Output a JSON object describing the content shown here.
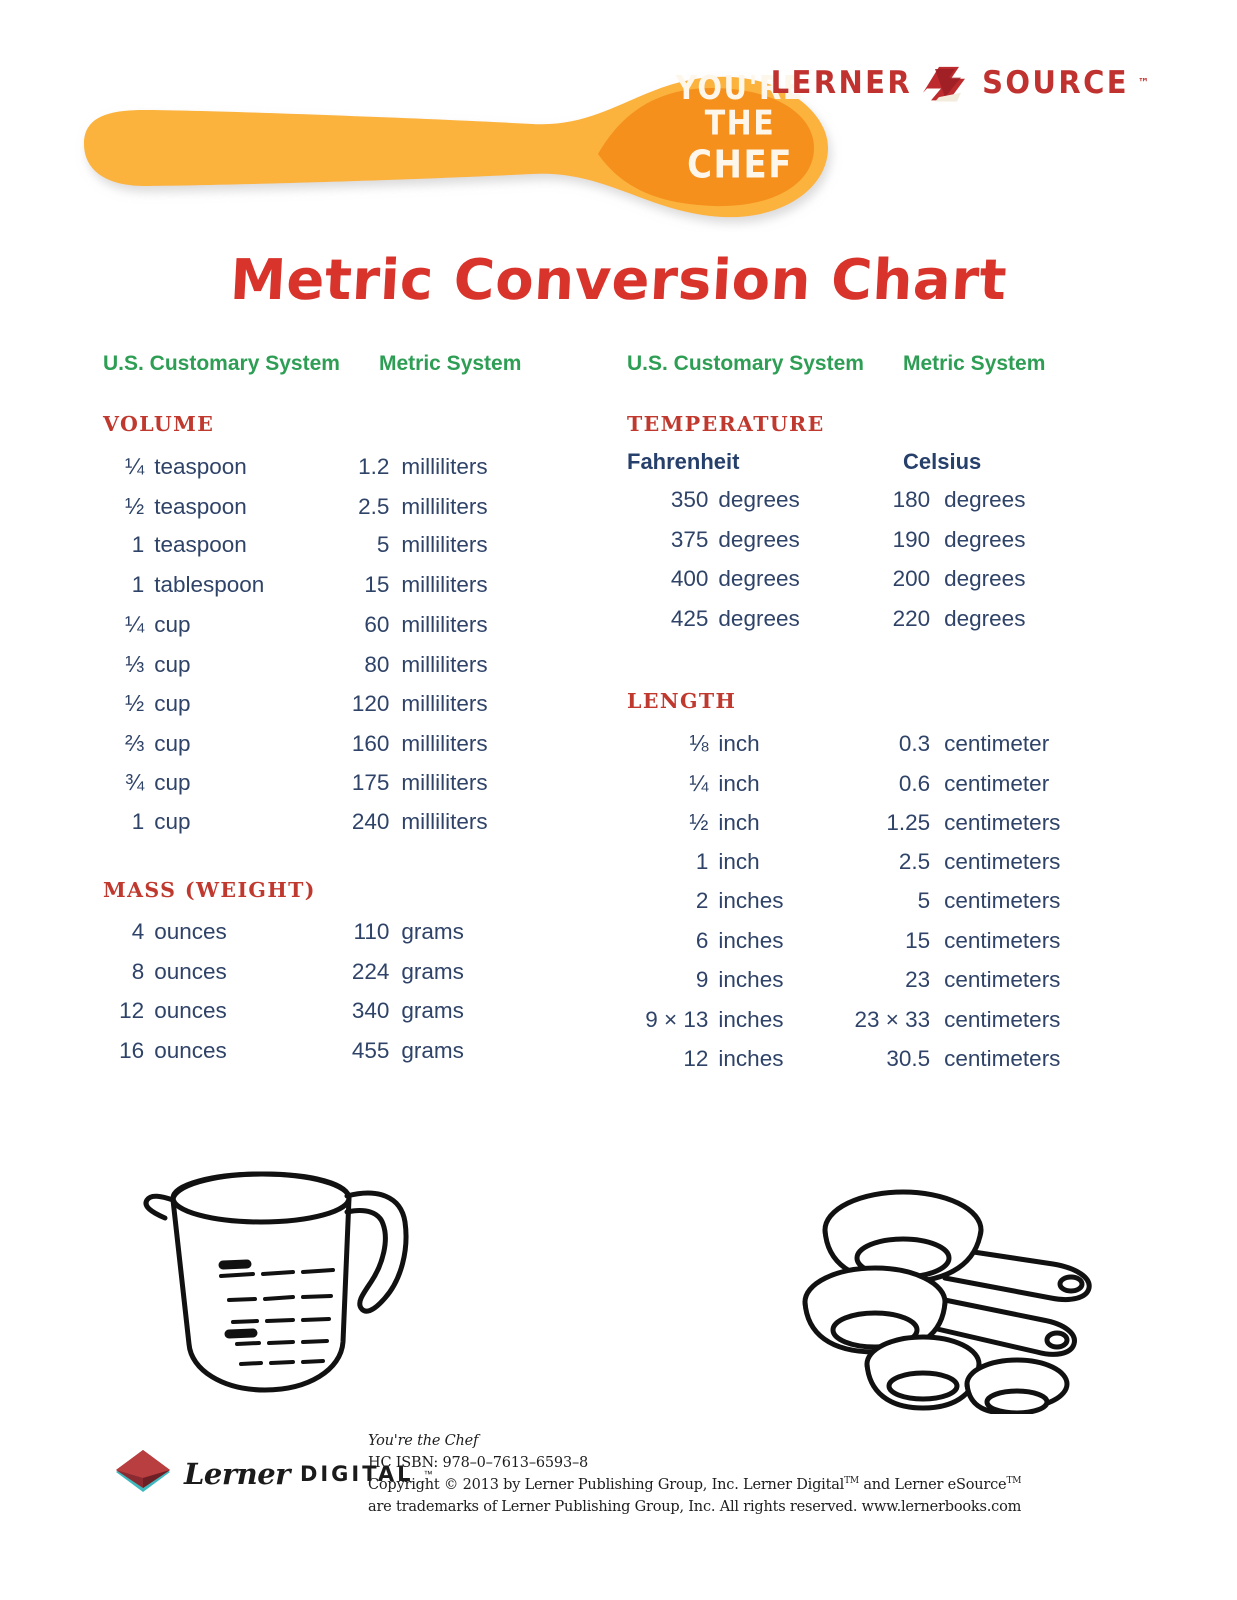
{
  "brand": {
    "spoon_line1": "YOU'RE",
    "spoon_line2_small": "THE",
    "spoon_line2_big": "CHEF",
    "esource_left": "LERNER",
    "esource_right": "SOURCE",
    "esource_tm": "™",
    "spoon_outer_color": "#FBB33C",
    "spoon_inner_color": "#F5901F",
    "esource_color": "#C0322F"
  },
  "title": "Metric Conversion Chart",
  "colors": {
    "title_red": "#D8342C",
    "section_red": "#C0392F",
    "header_green": "#2E9E55",
    "body_navy": "#2F4368"
  },
  "left_column": {
    "header_us": "U.S. Customary System",
    "header_metric": "Metric System",
    "sections": [
      {
        "title": "VOLUME",
        "rows": [
          {
            "qty": "¼",
            "unit": "teaspoon",
            "value": "1.2",
            "metric": "milliliters"
          },
          {
            "qty": "½",
            "unit": "teaspoon",
            "value": "2.5",
            "metric": "milliliters"
          },
          {
            "qty": "1",
            "unit": "teaspoon",
            "value": "5",
            "metric": "milliliters"
          },
          {
            "qty": "1",
            "unit": "tablespoon",
            "value": "15",
            "metric": "milliliters"
          },
          {
            "qty": "¼",
            "unit": "cup",
            "value": "60",
            "metric": "milliliters"
          },
          {
            "qty": "⅓",
            "unit": "cup",
            "value": "80",
            "metric": "milliliters"
          },
          {
            "qty": "½",
            "unit": "cup",
            "value": "120",
            "metric": "milliliters"
          },
          {
            "qty": "⅔",
            "unit": "cup",
            "value": "160",
            "metric": "milliliters"
          },
          {
            "qty": "¾",
            "unit": "cup",
            "value": "175",
            "metric": "milliliters"
          },
          {
            "qty": "1",
            "unit": "cup",
            "value": "240",
            "metric": "milliliters"
          }
        ]
      },
      {
        "title": "MASS (WEIGHT)",
        "rows": [
          {
            "qty": "4",
            "unit": "ounces",
            "value": "110",
            "metric": "grams"
          },
          {
            "qty": "8",
            "unit": "ounces",
            "value": "224",
            "metric": "grams"
          },
          {
            "qty": "12",
            "unit": "ounces",
            "value": "340",
            "metric": "grams"
          },
          {
            "qty": "16",
            "unit": "ounces",
            "value": "455",
            "metric": "grams"
          }
        ]
      }
    ]
  },
  "right_column": {
    "header_us": "U.S. Customary System",
    "header_metric": "Metric System",
    "sections": [
      {
        "title": "TEMPERATURE",
        "sub_us": "Fahrenheit",
        "sub_metric": "Celsius",
        "rows": [
          {
            "qty": "350",
            "unit": "degrees",
            "value": "180",
            "metric": "degrees"
          },
          {
            "qty": "375",
            "unit": "degrees",
            "value": "190",
            "metric": "degrees"
          },
          {
            "qty": "400",
            "unit": "degrees",
            "value": "200",
            "metric": "degrees"
          },
          {
            "qty": "425",
            "unit": "degrees",
            "value": "220",
            "metric": "degrees"
          }
        ]
      },
      {
        "title": "LENGTH",
        "rows": [
          {
            "qty": "⅛",
            "unit": "inch",
            "value": "0.3",
            "metric": "centimeter"
          },
          {
            "qty": "¼",
            "unit": "inch",
            "value": "0.6",
            "metric": "centimeter"
          },
          {
            "qty": "½",
            "unit": "inch",
            "value": "1.25",
            "metric": "centimeters"
          },
          {
            "qty": "1",
            "unit": "inch",
            "value": "2.5",
            "metric": "centimeters"
          },
          {
            "qty": "2",
            "unit": "inches",
            "value": "5",
            "metric": "centimeters"
          },
          {
            "qty": "6",
            "unit": "inches",
            "value": "15",
            "metric": "centimeters"
          },
          {
            "qty": "9",
            "unit": "inches",
            "value": "23",
            "metric": "centimeters"
          },
          {
            "qty": "9 × 13",
            "unit": "inches",
            "value": "23 × 33",
            "metric": "centimeters"
          },
          {
            "qty": "12",
            "unit": "inches",
            "value": "30.5",
            "metric": "centimeters"
          }
        ]
      }
    ]
  },
  "illustrations": {
    "left": "measuring-cup",
    "right": "measuring-cups-set"
  },
  "footer": {
    "logo_word": "Lerner",
    "logo_digital": "DIGITAL",
    "logo_tm": "™",
    "line1": "You're the Chef",
    "line2": "HC ISBN: 978–0–7613–6593–8",
    "line3_a": "Copyright © 2013 by Lerner Publishing Group, Inc. Lerner Digital",
    "line3_tm1": "TM",
    "line3_b": " and Lerner eSource",
    "line3_tm2": "TM",
    "line4": "are trademarks of Lerner Publishing Group, Inc. All rights reserved. www.lernerbooks.com"
  }
}
